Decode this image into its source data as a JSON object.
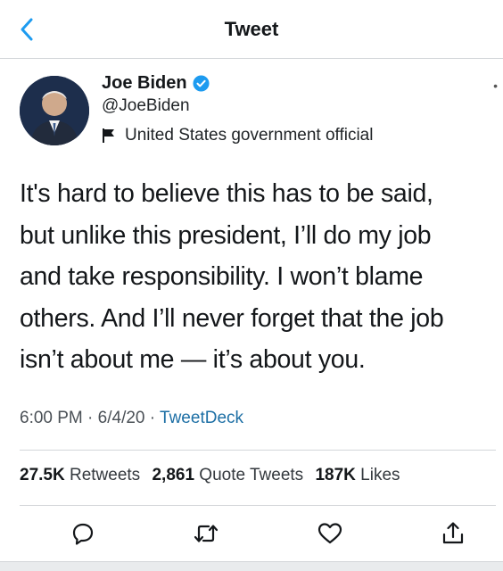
{
  "header": {
    "title": "Tweet",
    "back_icon": "chevron-left-icon"
  },
  "author": {
    "name": "Joe Biden",
    "handle": "@JoeBiden",
    "label": "United States government official",
    "verified_icon": "verified-badge-icon",
    "label_icon": "flag-icon"
  },
  "tweet": {
    "lines": [
      "It's hard to believe this has to be said,",
      "but unlike this president, I’ll do my job",
      "and take responsibility. I won’t blame",
      "others. And I’ll never forget that the job",
      "isn’t about me — it’s about you."
    ],
    "time": "6:00 PM",
    "date": "6/4/20",
    "source": "TweetDeck",
    "sep": "·"
  },
  "stats": {
    "retweets_count": "27.5K",
    "retweets_label": "Retweets",
    "quotes_count": "2,861",
    "quotes_label": "Quote Tweets",
    "likes_count": "187K",
    "likes_label": "Likes"
  },
  "actions": [
    "reply-icon",
    "retweet-icon",
    "like-icon",
    "share-icon"
  ],
  "colors": {
    "link": "#1d6fa5",
    "verified": "#1d9bf0",
    "divider": "#d3d6d9"
  }
}
